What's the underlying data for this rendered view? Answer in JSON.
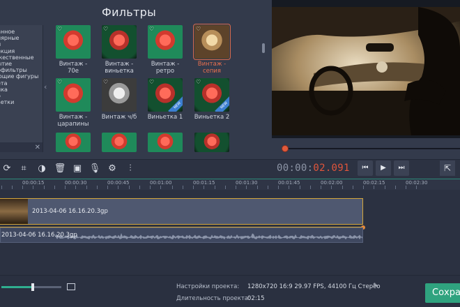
{
  "filters_panel": {
    "title": "Фильтры",
    "categories": [
      "анное",
      "лярные",
      "й",
      "екция",
      "жественные",
      "ытие",
      "офильтры",
      "ющие фигуры",
      "ета",
      "ика",
      "о",
      "ьетки"
    ],
    "thumbs": [
      {
        "label": "Винтаж -\n70е",
        "style": "red",
        "new": false,
        "selected": false
      },
      {
        "label": "Винтаж -\nвиньетка",
        "style": "red-dark",
        "new": false,
        "selected": false
      },
      {
        "label": "Винтаж -\nретро",
        "style": "red",
        "new": false,
        "selected": false
      },
      {
        "label": "Винтаж -\nсепия",
        "style": "sepia",
        "new": false,
        "selected": true
      },
      {
        "label": "Винтаж -\nцарапины",
        "style": "red",
        "new": false,
        "selected": false
      },
      {
        "label": "Винтаж ч/б",
        "style": "bw",
        "new": false,
        "selected": false
      },
      {
        "label": "Виньетка 1",
        "style": "red-dark",
        "new": true,
        "selected": false
      },
      {
        "label": "Виньетка 2",
        "style": "red-dark",
        "new": true,
        "selected": false
      }
    ]
  },
  "player": {
    "timecode_dim": "00:00:",
    "timecode_active": "02.091"
  },
  "toolbar": {
    "tools": [
      "rotate-icon",
      "crop-icon",
      "color-icon",
      "trash-icon",
      "image-icon",
      "mic-icon",
      "gear-icon",
      "equalizer-icon"
    ],
    "controls": [
      "prev-icon",
      "play-icon",
      "next-icon"
    ]
  },
  "ruler": {
    "ticks": [
      "00:00:15",
      "00:00:30",
      "00:00:45",
      "00:01:00",
      "00:01:15",
      "00:01:30",
      "00:01:45",
      "00:02:00",
      "00:02:15",
      "00:02:30"
    ]
  },
  "timeline": {
    "video_clip": "2013-04-06 16.16.20.3gp",
    "audio_clip": "2013-04-06 16.16.20.3gp"
  },
  "project": {
    "settings_label": "Настройки проекта:",
    "settings_value": "1280x720 16:9 29.97 FPS, 44100 Гц Стерео",
    "duration_label": "Длительность проекта:",
    "duration_value": "02:15"
  },
  "save_button": "Сохра",
  "colors": {
    "accent": "#2fa37f",
    "timecode": "#e0553b",
    "clip_border": "#d5a63a"
  }
}
